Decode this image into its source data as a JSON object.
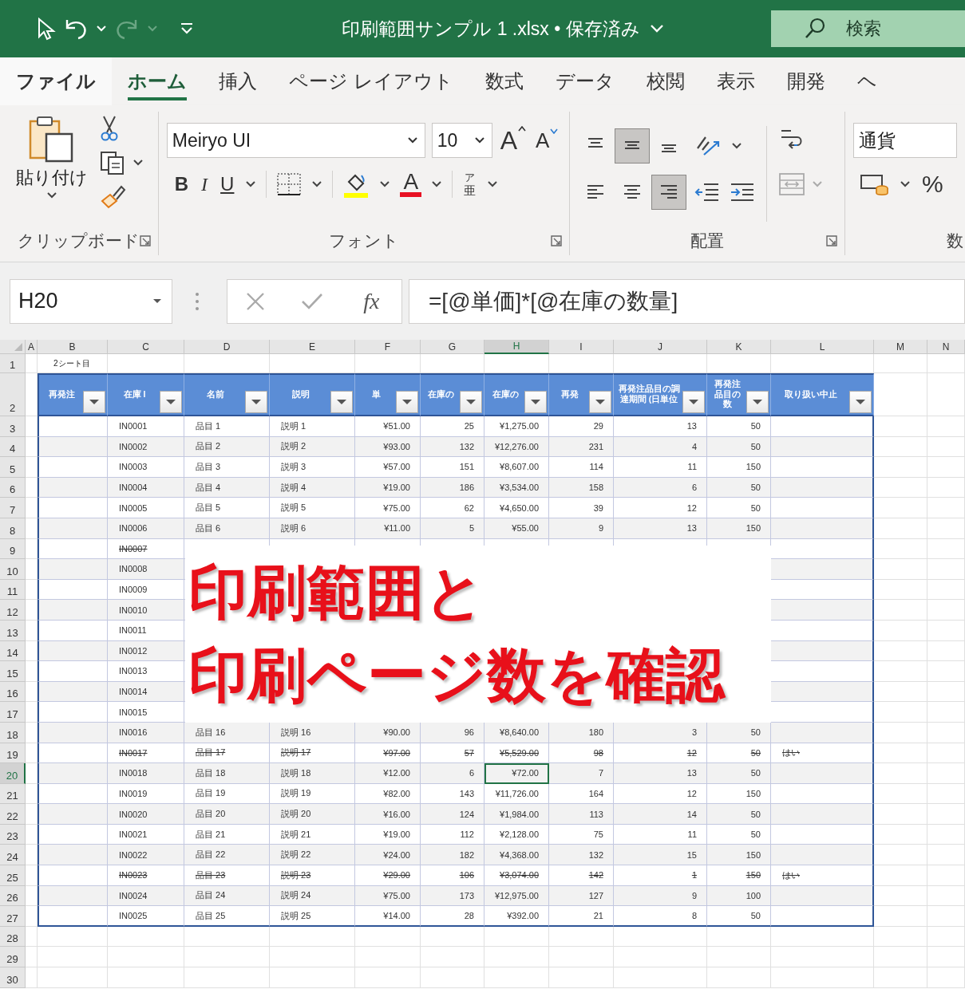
{
  "title_bar": {
    "title": "印刷範囲サンプル 1 .xlsx • 保存済み",
    "search": {
      "placeholder": "検索"
    }
  },
  "ribbon_tabs": [
    {
      "label": "ファイル",
      "selected": false
    },
    {
      "label": "ホーム",
      "selected": true
    },
    {
      "label": "挿入",
      "selected": false
    },
    {
      "label": "ページ レイアウト",
      "selected": false
    },
    {
      "label": "数式",
      "selected": false
    },
    {
      "label": "データ",
      "selected": false
    },
    {
      "label": "校閲",
      "selected": false
    },
    {
      "label": "表示",
      "selected": false
    },
    {
      "label": "開発",
      "selected": false
    },
    {
      "label": "ヘ",
      "selected": false
    }
  ],
  "ribbon": {
    "clipboard": {
      "paste_label": "貼り付け",
      "group_label": "クリップボード"
    },
    "font": {
      "font_name": "Meiryo UI",
      "font_size": "10",
      "grow_label": "A",
      "shrink_label": "A",
      "bold": "B",
      "italic": "I",
      "underline": "U",
      "font_color_label": "A",
      "phonetic_top": "ア",
      "phonetic_bottom": "亜",
      "group_label": "フォント"
    },
    "alignment": {
      "align_buttons": [
        {
          "kind": "top",
          "selected": false
        },
        {
          "kind": "middle",
          "selected": true
        },
        {
          "kind": "bottom",
          "selected": false
        },
        {
          "kind": "left",
          "selected": false
        },
        {
          "kind": "center",
          "selected": false
        },
        {
          "kind": "right",
          "selected": true
        }
      ],
      "group_label": "配置"
    },
    "number": {
      "format": "通貨",
      "percent": "%",
      "group_label": "数"
    }
  },
  "formula_bar": {
    "name_box": "H20",
    "fx": "fx",
    "formula": "=[@単価]*[@在庫の数量]"
  },
  "sheet": {
    "columns": [
      {
        "label": "A",
        "selected": false
      },
      {
        "label": "B",
        "selected": false
      },
      {
        "label": "C",
        "selected": false
      },
      {
        "label": "D",
        "selected": false
      },
      {
        "label": "E",
        "selected": false
      },
      {
        "label": "F",
        "selected": false
      },
      {
        "label": "G",
        "selected": false
      },
      {
        "label": "H",
        "selected": true
      },
      {
        "label": "I",
        "selected": false
      },
      {
        "label": "J",
        "selected": false
      },
      {
        "label": "K",
        "selected": false
      },
      {
        "label": "L",
        "selected": false
      },
      {
        "label": "M",
        "selected": false
      },
      {
        "label": "N",
        "selected": false
      }
    ],
    "note_row": {
      "number": "1",
      "text": "2シート目"
    },
    "header_row": {
      "number": "2",
      "headers": [
        "再発注",
        "在庫 I",
        "名前",
        "説明",
        "単",
        "在庫の",
        "在庫の",
        "再発",
        "再発注品目の調達期間 (日単位",
        "再発注品目の数",
        "取り扱い中止"
      ]
    },
    "rows": [
      {
        "number": "3",
        "selected": false,
        "strike": false,
        "cells": [
          "IN0001",
          "品目 1",
          "説明 1",
          "¥51.00",
          "25",
          "¥1,275.00",
          "29",
          "13",
          "50"
        ]
      },
      {
        "number": "4",
        "selected": false,
        "strike": false,
        "cells": [
          "IN0002",
          "品目 2",
          "説明 2",
          "¥93.00",
          "132",
          "¥12,276.00",
          "231",
          "4",
          "50"
        ]
      },
      {
        "number": "5",
        "selected": false,
        "strike": false,
        "cells": [
          "IN0003",
          "品目 3",
          "説明 3",
          "¥57.00",
          "151",
          "¥8,607.00",
          "114",
          "11",
          "150"
        ]
      },
      {
        "number": "6",
        "selected": false,
        "strike": false,
        "cells": [
          "IN0004",
          "品目 4",
          "説明 4",
          "¥19.00",
          "186",
          "¥3,534.00",
          "158",
          "6",
          "50"
        ]
      },
      {
        "number": "7",
        "selected": false,
        "strike": false,
        "cells": [
          "IN0005",
          "品目 5",
          "説明 5",
          "¥75.00",
          "62",
          "¥4,650.00",
          "39",
          "12",
          "50"
        ]
      },
      {
        "number": "8",
        "selected": false,
        "strike": false,
        "cells": [
          "IN0006",
          "品目 6",
          "説明 6",
          "¥11.00",
          "5",
          "¥55.00",
          "9",
          "13",
          "150"
        ]
      },
      {
        "number": "9",
        "selected": false,
        "strike": true,
        "cells": [
          "IN0007"
        ]
      },
      {
        "number": "10",
        "selected": false,
        "strike": false,
        "cells": [
          "IN0008"
        ]
      },
      {
        "number": "11",
        "selected": false,
        "strike": false,
        "cells": [
          "IN0009"
        ]
      },
      {
        "number": "12",
        "selected": false,
        "strike": false,
        "cells": [
          "IN0010"
        ]
      },
      {
        "number": "13",
        "selected": false,
        "strike": false,
        "cells": [
          "IN0011"
        ]
      },
      {
        "number": "14",
        "selected": false,
        "strike": false,
        "cells": [
          "IN0012"
        ]
      },
      {
        "number": "15",
        "selected": false,
        "strike": false,
        "cells": [
          "IN0013"
        ]
      },
      {
        "number": "16",
        "selected": false,
        "strike": false,
        "cells": [
          "IN0014"
        ]
      },
      {
        "number": "17",
        "selected": false,
        "strike": false,
        "cells": [
          "IN0015"
        ]
      },
      {
        "number": "18",
        "selected": false,
        "strike": false,
        "cells": [
          "IN0016",
          "品目 16",
          "説明 16",
          "¥90.00",
          "96",
          "¥8,640.00",
          "180",
          "3",
          "50"
        ]
      },
      {
        "number": "19",
        "selected": false,
        "strike": true,
        "cells": [
          "IN0017",
          "品目 17",
          "説明 17",
          "¥97.00",
          "57",
          "¥5,529.00",
          "98",
          "12",
          "50",
          "はい"
        ]
      },
      {
        "number": "20",
        "selected": true,
        "strike": false,
        "cells": [
          "IN0018",
          "品目 18",
          "説明 18",
          "¥12.00",
          "6",
          "¥72.00",
          "7",
          "13",
          "50"
        ]
      },
      {
        "number": "21",
        "selected": false,
        "strike": false,
        "cells": [
          "IN0019",
          "品目 19",
          "説明 19",
          "¥82.00",
          "143",
          "¥11,726.00",
          "164",
          "12",
          "150"
        ]
      },
      {
        "number": "22",
        "selected": false,
        "strike": false,
        "cells": [
          "IN0020",
          "品目 20",
          "説明 20",
          "¥16.00",
          "124",
          "¥1,984.00",
          "113",
          "14",
          "50"
        ]
      },
      {
        "number": "23",
        "selected": false,
        "strike": false,
        "cells": [
          "IN0021",
          "品目 21",
          "説明 21",
          "¥19.00",
          "112",
          "¥2,128.00",
          "75",
          "11",
          "50"
        ]
      },
      {
        "number": "24",
        "selected": false,
        "strike": false,
        "cells": [
          "IN0022",
          "品目 22",
          "説明 22",
          "¥24.00",
          "182",
          "¥4,368.00",
          "132",
          "15",
          "150"
        ]
      },
      {
        "number": "25",
        "selected": false,
        "strike": true,
        "cells": [
          "IN0023",
          "品目 23",
          "説明 23",
          "¥29.00",
          "106",
          "¥3,074.00",
          "142",
          "1",
          "150",
          "はい"
        ]
      },
      {
        "number": "26",
        "selected": false,
        "strike": false,
        "cells": [
          "IN0024",
          "品目 24",
          "説明 24",
          "¥75.00",
          "173",
          "¥12,975.00",
          "127",
          "9",
          "100"
        ]
      },
      {
        "number": "27",
        "selected": false,
        "strike": false,
        "cells": [
          "IN0025",
          "品目 25",
          "説明 25",
          "¥14.00",
          "28",
          "¥392.00",
          "21",
          "8",
          "50"
        ]
      },
      {
        "number": "28"
      },
      {
        "number": "29"
      },
      {
        "number": "30"
      }
    ]
  },
  "overlay": {
    "lines": [
      "印刷範囲と",
      "印刷ページ数を確認"
    ]
  }
}
